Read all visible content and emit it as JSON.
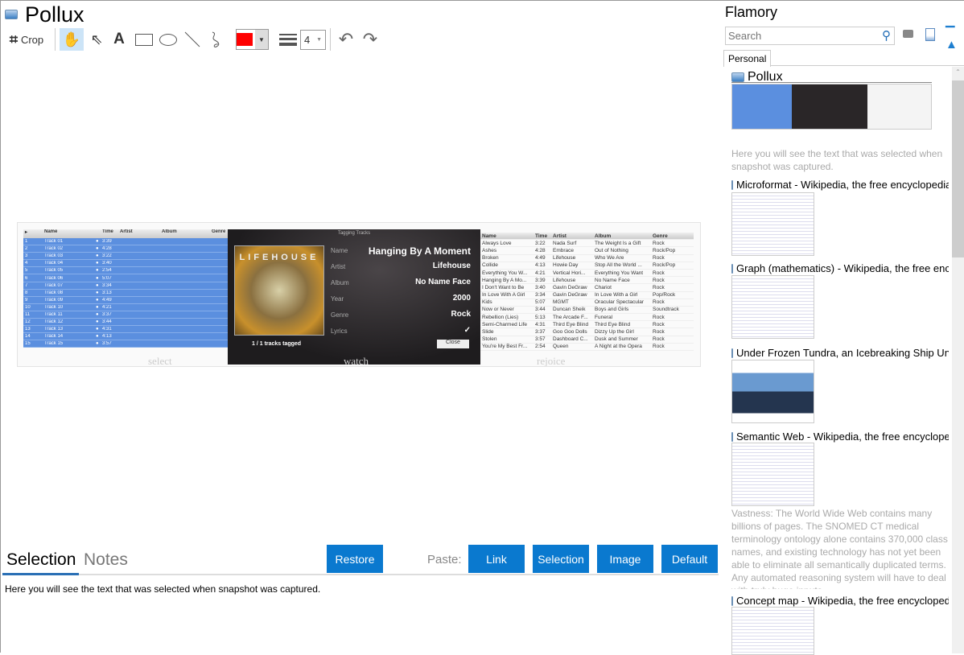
{
  "window": {
    "title": "Pollux"
  },
  "toolbar": {
    "crop_label": "Crop",
    "line_width": "4",
    "color": "#ff0000"
  },
  "snapshot": {
    "left_table": {
      "headers": [
        "Name",
        "Time",
        "Artist",
        "Album",
        "Genre"
      ],
      "rows": [
        [
          "1",
          "Track 01",
          "3:39"
        ],
        [
          "2",
          "Track 02",
          "4:28"
        ],
        [
          "3",
          "Track 03",
          "3:22"
        ],
        [
          "4",
          "Track 04",
          "3:40"
        ],
        [
          "5",
          "Track 05",
          "2:54"
        ],
        [
          "6",
          "Track 06",
          "5:07"
        ],
        [
          "7",
          "Track 07",
          "3:34"
        ],
        [
          "8",
          "Track 08",
          "3:13"
        ],
        [
          "9",
          "Track 09",
          "4:49"
        ],
        [
          "10",
          "Track 10",
          "4:21"
        ],
        [
          "11",
          "Track 11",
          "3:37"
        ],
        [
          "12",
          "Track 12",
          "3:44"
        ],
        [
          "13",
          "Track 13",
          "4:31"
        ],
        [
          "14",
          "Track 14",
          "4:13"
        ],
        [
          "15",
          "Track 15",
          "3:57"
        ]
      ]
    },
    "tagging": {
      "title": "Tagging Tracks",
      "art_text": "LIFEHOUSE",
      "fields": [
        [
          "Name",
          "Hanging By A Moment"
        ],
        [
          "Artist",
          "Lifehouse"
        ],
        [
          "Album",
          "No Name Face"
        ],
        [
          "Year",
          "2000"
        ],
        [
          "Genre",
          "Rock"
        ],
        [
          "Lyrics",
          "✓"
        ]
      ],
      "status": "1 / 1 tracks tagged",
      "close": "Close"
    },
    "right_table": {
      "headers": [
        "Name",
        "Time",
        "Artist",
        "Album",
        "Genre"
      ],
      "rows": [
        [
          "Always Love",
          "3:22",
          "Nada Surf",
          "The Weight Is a Gift",
          "Rock"
        ],
        [
          "Ashes",
          "4:28",
          "Embrace",
          "Out of Nothing",
          "Rock/Pop"
        ],
        [
          "Broken",
          "4:49",
          "Lifehouse",
          "Who We Are",
          "Rock"
        ],
        [
          "Collide",
          "4:13",
          "Howie Day",
          "Stop All the World ...",
          "Rock/Pop"
        ],
        [
          "Everything You W...",
          "4:21",
          "Vertical Hori...",
          "Everything You Want",
          "Rock"
        ],
        [
          "Hanging By A Mo...",
          "3:39",
          "Lifehouse",
          "No Name Face",
          "Rock"
        ],
        [
          "I Don't Want to Be",
          "3:40",
          "Gavin DeGraw",
          "Chariot",
          "Rock"
        ],
        [
          "In Love With A Girl",
          "3:34",
          "Gavin DeGraw",
          "In Love With a Girl",
          "Pop/Rock"
        ],
        [
          "Kids",
          "5:07",
          "MGMT",
          "Oracular Spectacular",
          "Rock"
        ],
        [
          "Now or Never",
          "3:44",
          "Duncan Sheik",
          "Boys and Girls",
          "Soundtrack"
        ],
        [
          "Rebellion (Lies)",
          "5:13",
          "The Arcade F...",
          "Funeral",
          "Rock"
        ],
        [
          "Semi-Charmed Life",
          "4:31",
          "Third Eye Blind",
          "Third Eye Blind",
          "Rock"
        ],
        [
          "Slide",
          "3:37",
          "Goo Goo Dolls",
          "Dizzy Up the Girl",
          "Rock"
        ],
        [
          "Stolen",
          "3:57",
          "Dashboard C...",
          "Dusk and Summer",
          "Rock"
        ],
        [
          "You're My Best Fr...",
          "2:54",
          "Queen",
          "A Night at the Opera",
          "Rock"
        ]
      ]
    },
    "captions": [
      "select",
      "watch",
      "rejoice"
    ]
  },
  "bottom": {
    "tabs": [
      "Selection",
      "Notes"
    ],
    "restore": "Restore",
    "paste_label": "Paste:",
    "paste_buttons": [
      "Link",
      "Selection",
      "Image",
      "Default"
    ],
    "selection_text": "Here you will see the text that was selected when snapshot was captured."
  },
  "sidebar": {
    "title": "Flamory",
    "search_placeholder": "Search",
    "tab": "Personal",
    "items": [
      {
        "title": "Pollux",
        "text": "Here you will see the text that was selected when snapshot was captured."
      },
      {
        "title": "Microformat - Wikipedia, the free encyclopedia"
      },
      {
        "title": "Graph (mathematics) - Wikipedia, the free encyclopedia"
      },
      {
        "title": "Under Frozen Tundra, an Icebreaking Ship Uncovers"
      },
      {
        "title": "Semantic Web - Wikipedia, the free encyclopedia",
        "text": "Vastness: The World Wide Web contains many billions of pages. The SNOMED CT medical terminology ontology alone contains 370,000 class names, and existing technology has not yet been able to eliminate all semantically duplicated terms. Any automated reasoning system will have to deal with truly huge inputs."
      },
      {
        "title": "Concept map - Wikipedia, the free encyclopedia"
      }
    ]
  }
}
